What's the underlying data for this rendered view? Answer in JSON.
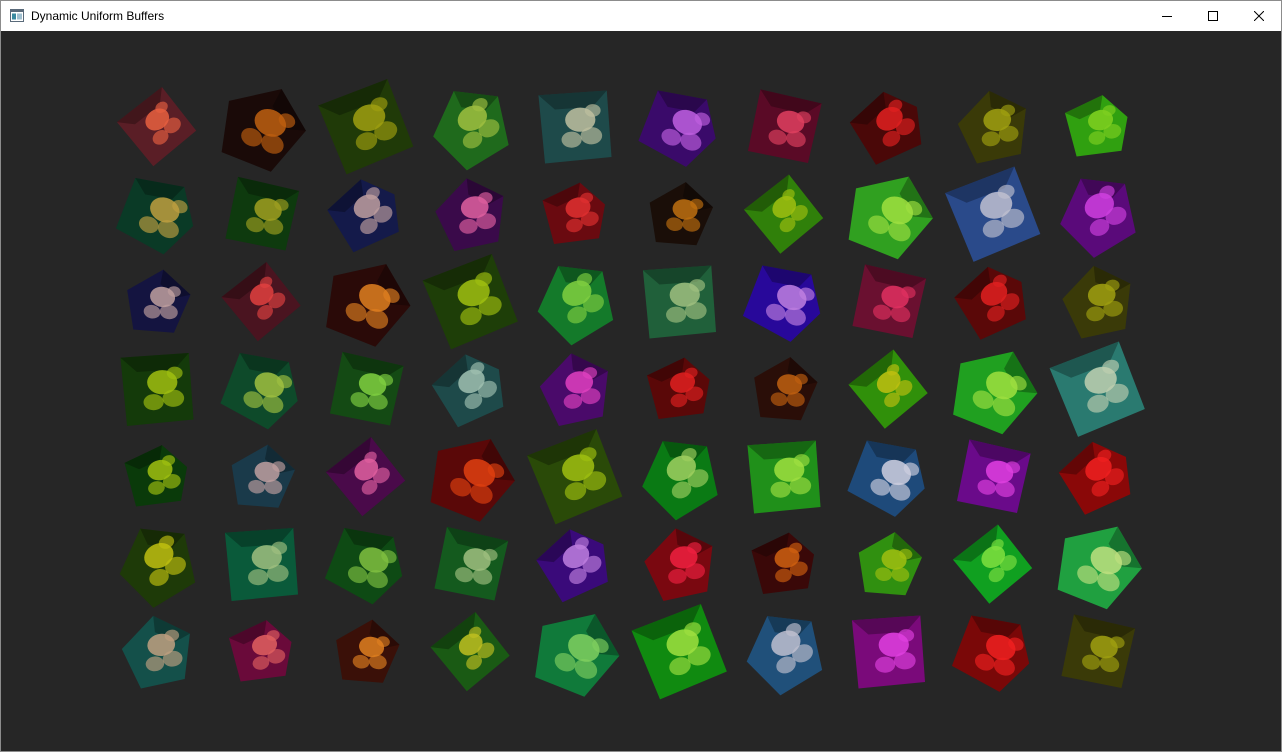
{
  "window": {
    "title": "Dynamic Uniform Buffers",
    "app_icon": "window-app-icon",
    "controls": {
      "minimize_icon": "minimize-icon",
      "maximize_icon": "maximize-icon",
      "close_icon": "close-icon"
    }
  },
  "scene": {
    "background_color": "#262626",
    "rows": 7,
    "columns": 10,
    "cube_colors": [
      [
        "#5a1e26",
        "#1a0a08",
        "#203a08",
        "#1f6a1c",
        "#1e4a4a",
        "#3a0a6a",
        "#5a0a26",
        "#4a0808",
        "#3a3a08",
        "#30a010"
      ],
      [
        "#0a3a26",
        "#0e3a0e",
        "#141a4a",
        "#3a0a4a",
        "#6a0a10",
        "#1a0e08",
        "#30800a",
        "#30a020",
        "#2a4a8a",
        "#5a0a7a"
      ],
      [
        "#141440",
        "#4a1420",
        "#2a0a08",
        "#1e3e08",
        "#147a2a",
        "#20603a",
        "#28089a",
        "#6a1030",
        "#5a0808",
        "#3a3a08"
      ],
      [
        "#143a0a",
        "#0e4a2a",
        "#144a14",
        "#1e4a4a",
        "#4a0a6a",
        "#5a0808",
        "#2a0e08",
        "#30900a",
        "#20a020",
        "#2a7a70"
      ],
      [
        "#0a3a0a",
        "#1a3a4a",
        "#4a0a4a",
        "#5a0808",
        "#2a4a08",
        "#0a7a14",
        "#20901a",
        "#1e4a7a",
        "#6a0a8a",
        "#8a0808"
      ],
      [
        "#1e3a08",
        "#0a5a3a",
        "#0e4a14",
        "#145a1e",
        "#3a0a7a",
        "#7a0810",
        "#3a0808",
        "#309010",
        "#10a020",
        "#20a040"
      ],
      [
        "#14504a",
        "#6a0a3a",
        "#3a1008",
        "#1a5a14",
        "#107a3a",
        "#108a10",
        "#20507a",
        "#7a0a7a",
        "#7a0808",
        "#3a3a08"
      ]
    ],
    "texture_tints": [
      [
        "#e86040",
        "#c06010",
        "#a0a010",
        "#a0c040",
        "#c0c0a0",
        "#c060e0",
        "#e04060",
        "#e02020",
        "#a0a010",
        "#80d020"
      ],
      [
        "#c0a040",
        "#a0a020",
        "#c0a0a0",
        "#e060a0",
        "#e03030",
        "#c07010",
        "#a0c010",
        "#a0e040",
        "#c0c0d0",
        "#d040e0"
      ],
      [
        "#c0a0a0",
        "#e04040",
        "#e08020",
        "#a0c010",
        "#80d040",
        "#a0c080",
        "#c080e0",
        "#e03060",
        "#e02020",
        "#a0a010"
      ],
      [
        "#a0c010",
        "#a0c040",
        "#80d040",
        "#a0c0b0",
        "#e040c0",
        "#e02020",
        "#c06010",
        "#c0c010",
        "#a0e040",
        "#c0d0b0"
      ],
      [
        "#a0c010",
        "#c0a0a0",
        "#e060a0",
        "#e04010",
        "#a0c010",
        "#a0d060",
        "#a0e040",
        "#d0d0e0",
        "#e040e0",
        "#f02020"
      ],
      [
        "#c0c010",
        "#a0c080",
        "#80c040",
        "#a0c080",
        "#c080e0",
        "#f02040",
        "#d06010",
        "#a0c010",
        "#80e040",
        "#c0e080"
      ],
      [
        "#c0a080",
        "#e06060",
        "#e08020",
        "#c0c020",
        "#80d060",
        "#a0e040",
        "#c0c0d0",
        "#e040e0",
        "#f02020",
        "#a0a010"
      ]
    ]
  }
}
